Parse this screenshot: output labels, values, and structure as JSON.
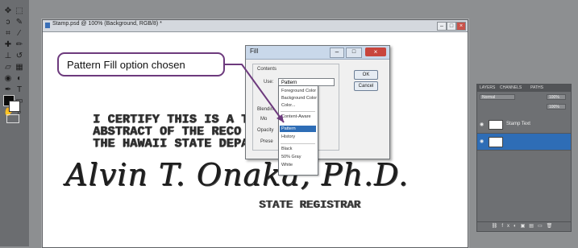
{
  "document": {
    "title": "Stamp.psd @ 100% (Background, RGB/8) *",
    "certify_lines": [
      "I CERTIFY THIS IS A TRUE",
      "ABSTRACT OF THE RECO",
      "THE HAWAII STATE DEPA"
    ],
    "signature": "Alvin T. Onaka, Ph.D.",
    "registrar": "STATE REGISTRAR"
  },
  "callout": {
    "text": "Pattern Fill option chosen",
    "border_color": "#6d3a7d"
  },
  "fill_dialog": {
    "title": "Fill",
    "contents_label": "Contents",
    "use_label": "Use:",
    "use_value": "Pattern",
    "ok_label": "OK",
    "cancel_label": "Cancel",
    "blending_label": "Blendin",
    "mode_label": "Mo",
    "opacity_label": "Opacity",
    "preserve_label": "Prese"
  },
  "use_dropdown": {
    "options": [
      "Foreground Color",
      "Background Color",
      "Color...",
      "Content-Aware",
      "Pattern",
      "History",
      "Black",
      "50% Gray",
      "White"
    ],
    "selected": "Pattern",
    "selected_color": "#2e6db6"
  },
  "layers_panel": {
    "tabs": [
      "LAYERS",
      "CHANNELS",
      "PATHS"
    ],
    "blend_mode": "Normal",
    "opacity": "100%",
    "fill": "100%",
    "layers": [
      {
        "name": "Stamp Text",
        "highlight": false
      },
      {
        "name": "",
        "highlight": true
      }
    ],
    "highlight_color": "#2e6db6"
  }
}
